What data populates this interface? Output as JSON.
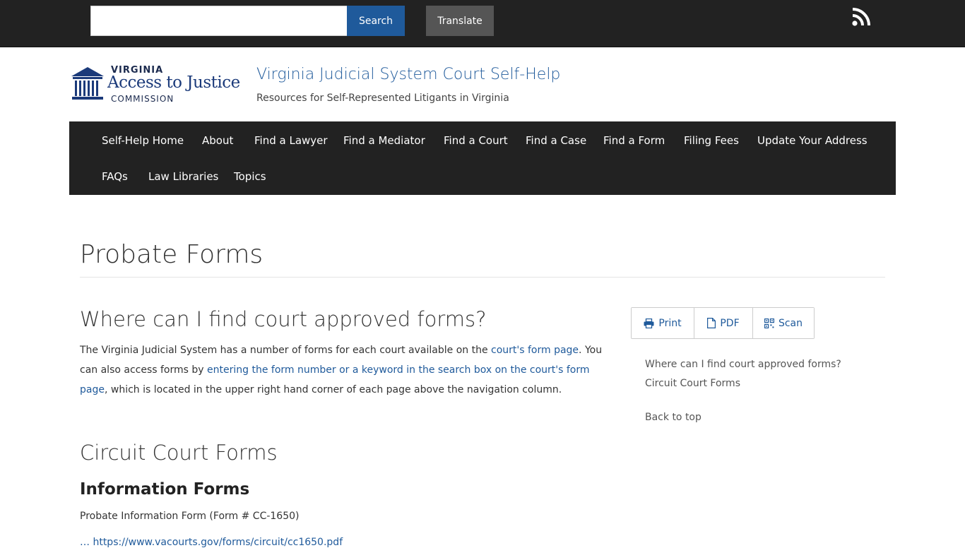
{
  "topbar": {
    "search_value": "",
    "search_label": "Search",
    "translate_label": "Translate",
    "rss_icon": "rss-icon"
  },
  "header": {
    "logo": {
      "line1": "VIRGINIA",
      "line2": "Access to Justice",
      "line3": "COMMISSION"
    },
    "site_title": "Virginia Judicial System Court Self-Help",
    "site_slogan": "Resources for Self-Represented Litigants in Virginia"
  },
  "nav": {
    "items": [
      "Self-Help Home",
      "About",
      "Find a Lawyer",
      "Find a Mediator",
      "Find a Court",
      "Find a Case",
      "Find a Form",
      "Filing Fees",
      "Update Your Address",
      "FAQs",
      "Law Libraries",
      "Topics"
    ]
  },
  "content": {
    "page_title": "Probate Forms",
    "where_heading": "Where can I find court approved forms?",
    "para": {
      "t1": "The Virginia Judicial System has a number of forms for each court available on the ",
      "link1": "court's form page",
      "t2": ". You can also access forms by ",
      "link2": "entering the form number or a keyword in the search box on the court's form page",
      "t3": ", which is located in the upper right hand corner of each page above the navigation column."
    },
    "circuit_heading": "Circuit Court Forms",
    "info_heading": "Information Forms",
    "form_line": "Probate Information Form (Form # CC-1650)",
    "cut_link": "… https://www.vacourts.gov/forms/circuit/cc1650.pdf"
  },
  "sidebar": {
    "tools": {
      "print": "Print",
      "pdf": "PDF",
      "scan": "Scan"
    },
    "toc": [
      "Where can I find court approved forms?",
      "Circuit Court Forms"
    ],
    "back_to_top": "Back to top"
  },
  "colors": {
    "topbar_bg": "#222222",
    "accent": "#1f5a9b",
    "translate_bg": "#555555"
  }
}
